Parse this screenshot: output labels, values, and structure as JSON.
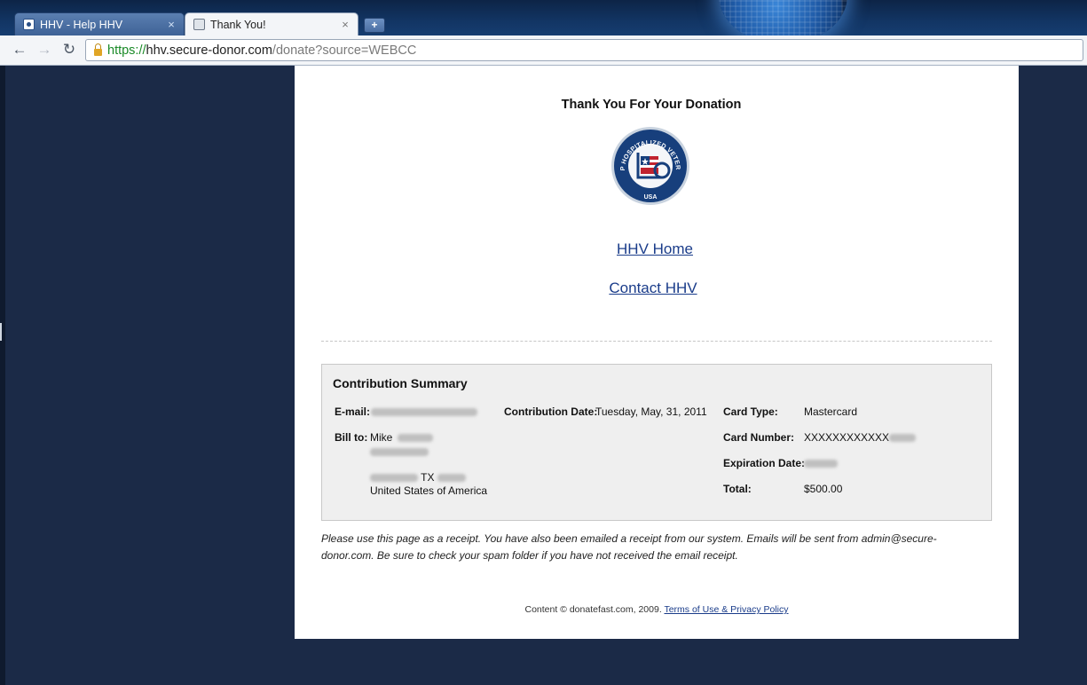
{
  "browser": {
    "tabs": [
      {
        "title": "HHV - Help HHV",
        "close": "×"
      },
      {
        "title": "Thank You!",
        "close": "×"
      }
    ],
    "new_tab_label": "+",
    "nav": {
      "back": "←",
      "forward": "→",
      "reload": "↻"
    },
    "url": {
      "scheme": "https://",
      "host": "hhv.secure-donor.com",
      "path": "/donate?source=WEBCC"
    }
  },
  "page": {
    "heading": "Thank You For Your Donation",
    "logo": {
      "text_top": "HELP HOSPITALIZED VETERANS",
      "text_bottom": "USA"
    },
    "links": {
      "home": "HHV Home",
      "contact": "Contact HHV"
    },
    "summary": {
      "title": "Contribution Summary",
      "email_label": "E-mail:",
      "billto_label": "Bill to:",
      "billto_first_name": "Mike",
      "billto_state": "TX",
      "billto_country": "United States of America",
      "date_label": "Contribution Date:",
      "date_value": "Tuesday, May, 31, 2011",
      "card_type_label": "Card Type:",
      "card_type_value": "Mastercard",
      "card_number_label": "Card Number:",
      "card_number_value": "XXXXXXXXXXXX",
      "expiration_label": "Expiration Date:",
      "total_label": "Total:",
      "total_value": "$500.00"
    },
    "receipt_note": "Please use this page as a receipt. You have also been emailed a receipt from our system. Emails will be sent from admin@secure-donor.com. Be sure to check your spam folder if you have not received the email receipt.",
    "footer": {
      "prefix": "Content © donatefast.com, 2009.",
      "link": "Terms of Use & Privacy Policy"
    }
  },
  "colors": {
    "background": "#1b2a47",
    "link": "#1a3c8a",
    "url_secure": "#1a8a27"
  }
}
